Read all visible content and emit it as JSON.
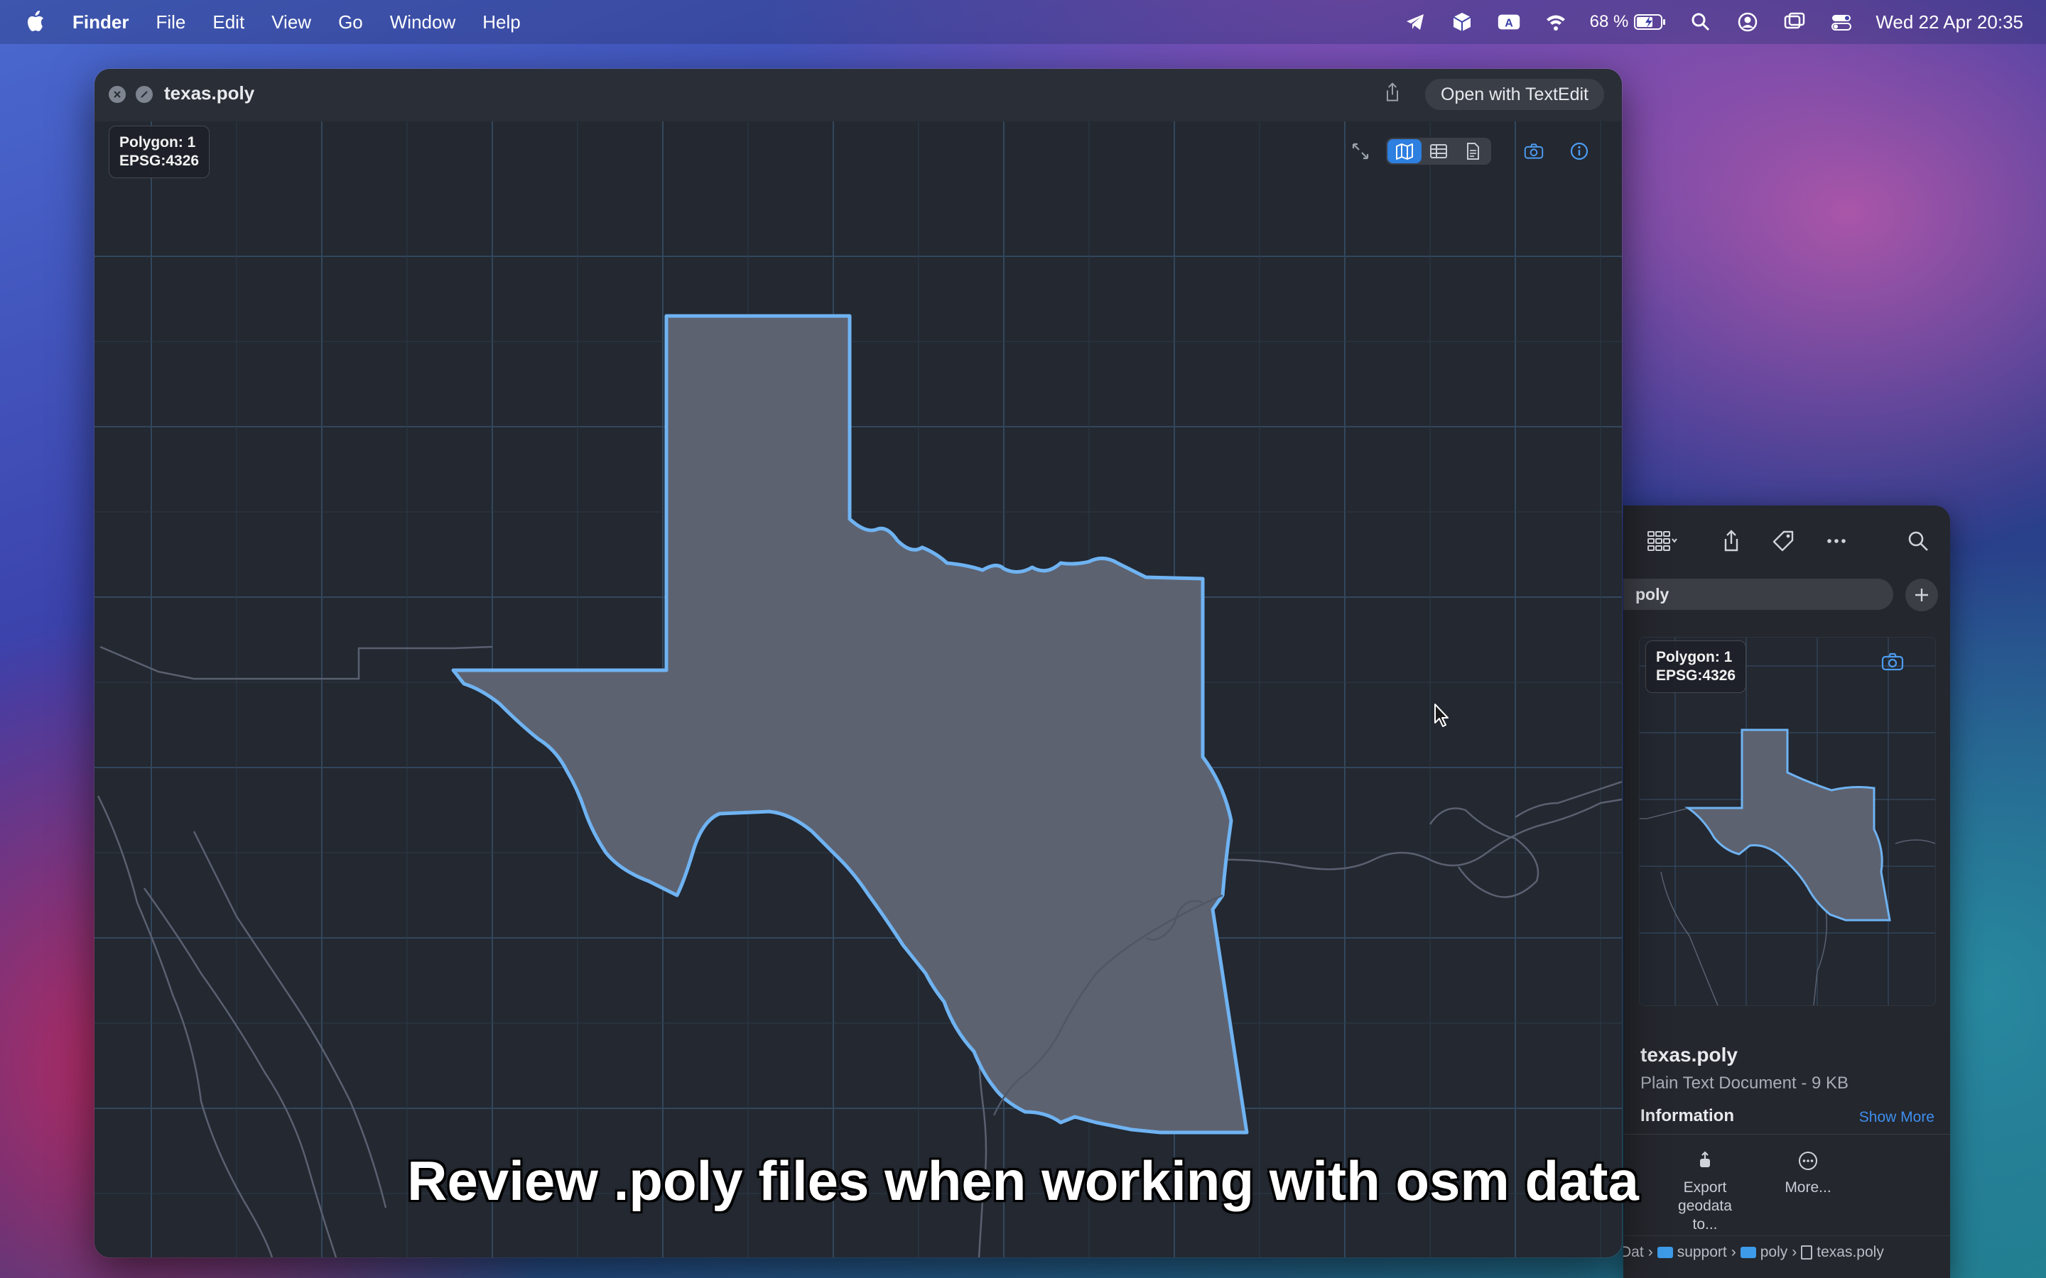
{
  "menubar": {
    "app_name": "Finder",
    "menus": [
      "File",
      "Edit",
      "View",
      "Go",
      "Window",
      "Help"
    ],
    "battery_percent": "68 %",
    "datetime": "Wed 22 Apr  20:35",
    "status_icons": [
      "telegram-icon",
      "cube-icon",
      "keyboard-a-icon",
      "wifi-icon",
      "battery-icon",
      "spotlight-icon",
      "user-icon",
      "screen-mirror-icon",
      "control-center-icon"
    ]
  },
  "quicklook": {
    "title": "texas.poly",
    "open_with_label": "Open with TextEdit",
    "info_badge": {
      "line1": "Polygon: 1",
      "line2": "EPSG:4326"
    },
    "view_modes": [
      "map",
      "table",
      "text"
    ],
    "active_view": "map"
  },
  "finder": {
    "search_value": "poly",
    "preview_badge": {
      "line1": "Polygon: 1",
      "line2": "EPSG:4326"
    },
    "file_name": "texas.poly",
    "file_kind": "Plain Text Document - 9 KB",
    "info_heading": "Information",
    "show_more": "Show More",
    "actions": [
      {
        "label": "Export\ngeodata to...",
        "icon": "export-icon"
      },
      {
        "label": "More...",
        "icon": "more-circle-icon"
      }
    ],
    "path": [
      "Dat",
      "support",
      "poly",
      "texas.poly"
    ]
  },
  "caption": "Review .poly files when working with osm data",
  "colors": {
    "accent": "#2d7fe0",
    "polygon_fill": "#5d6270",
    "polygon_stroke": "#6fb3f2",
    "map_background": "#232831",
    "grid": "#3a5066"
  }
}
